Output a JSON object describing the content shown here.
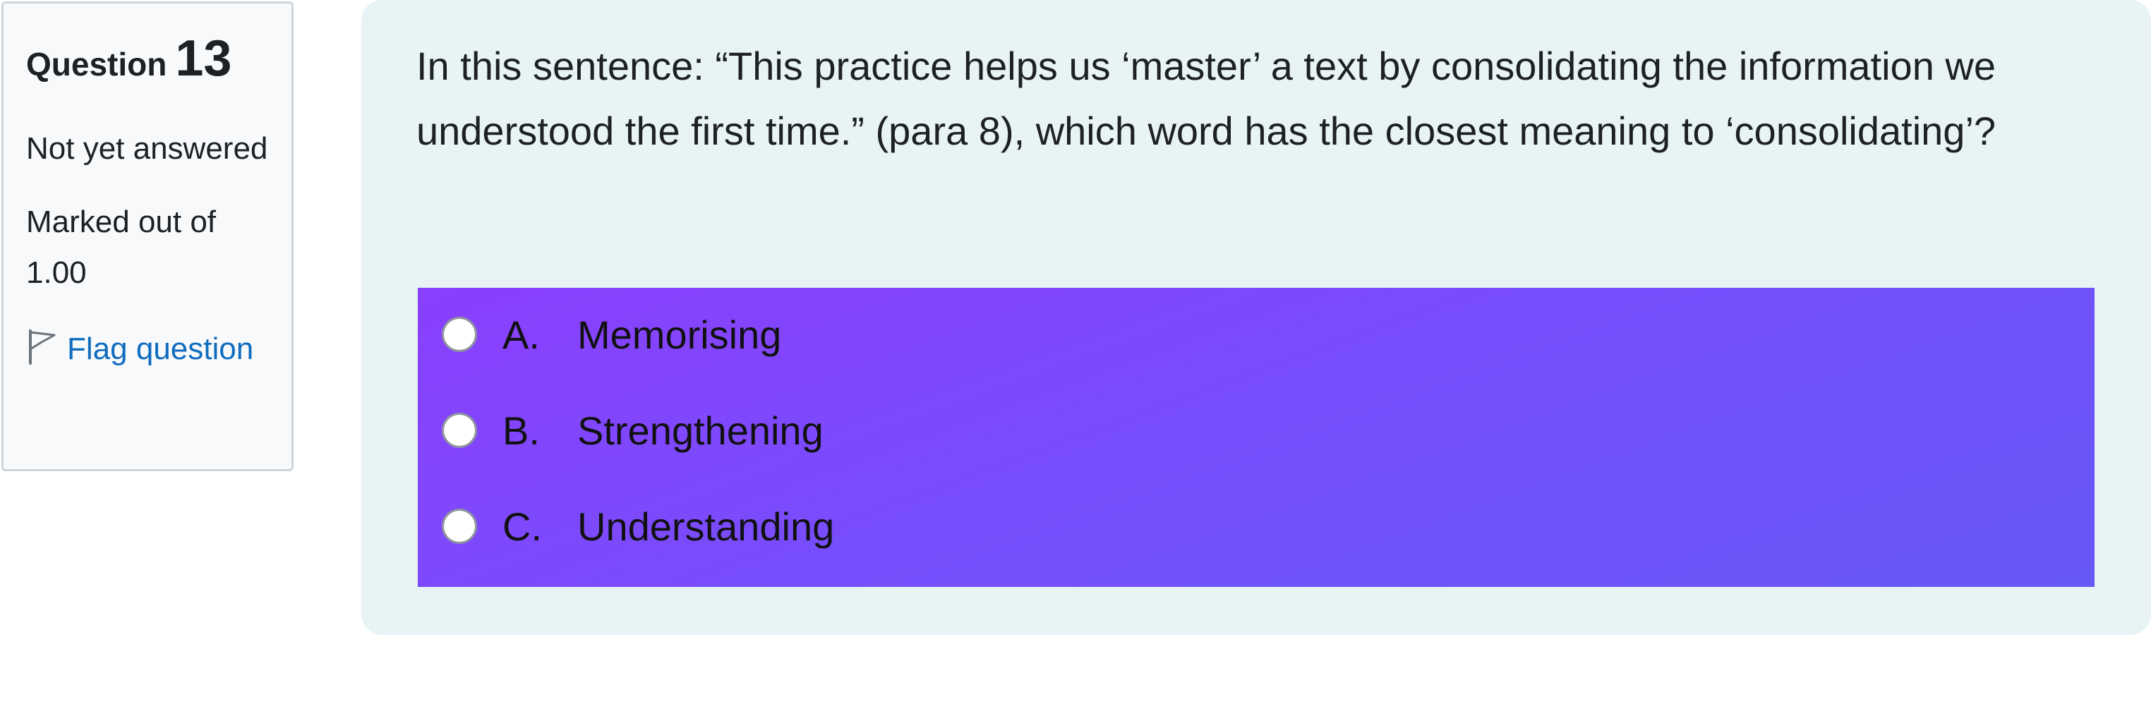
{
  "question_info": {
    "label": "Question",
    "number": "13",
    "state": "Not yet answered",
    "grade": "Marked out of 1.00",
    "flag_label": "Flag question"
  },
  "question": {
    "text": "In this sentence: “This practice helps us ‘master’ a text by consolidating the information we understood the first time.” (para 8), which word has the closest meaning to ‘consolidating’?"
  },
  "answers": [
    {
      "letter": "A.",
      "text": "Memorising"
    },
    {
      "letter": "B.",
      "text": "Strengthening"
    },
    {
      "letter": "C.",
      "text": "Understanding"
    }
  ],
  "colors": {
    "panel_bg": "#e7f3f5",
    "answer_gradient_start": "#8a3ffc",
    "answer_gradient_end": "#6658f5",
    "link": "#0f6cbf"
  },
  "icons": {
    "flag": "flag-icon"
  }
}
